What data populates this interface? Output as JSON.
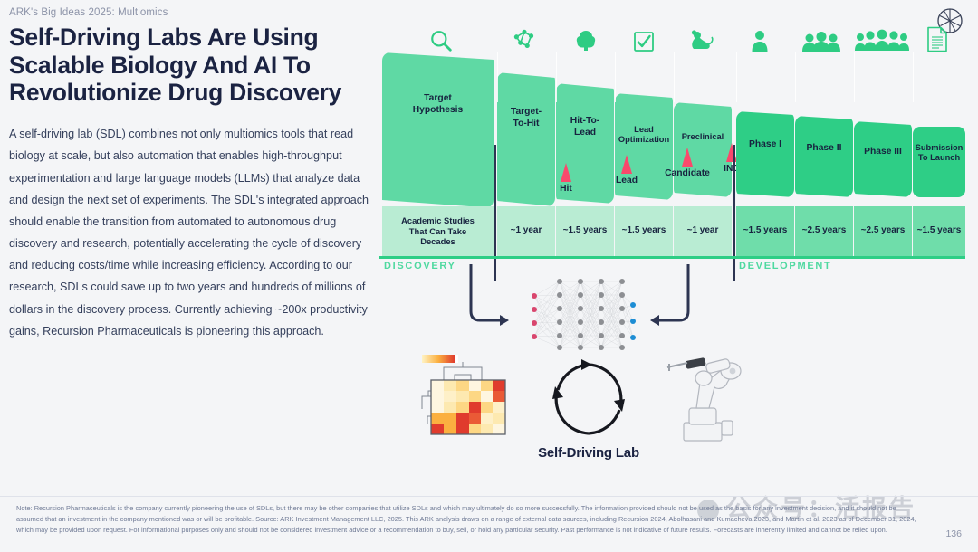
{
  "header": {
    "eyebrow": "ARK's Big Ideas 2025: Multiomics",
    "headline": "Self-Driving Labs Are Using Scalable Biology And AI To Revolutionize Drug Discovery",
    "logo_icon": "ark-logo-icon"
  },
  "body": {
    "paragraph": "A self-driving lab (SDL) combines not only multiomics tools that read biology at scale, but also automation that enables high-throughput experimentation and large language models (LLMs) that analyze data and design the next set of experiments. The SDL's integrated approach should enable the transition from automated to autonomous drug discovery and research, potentially accelerating the cycle of discovery and reducing costs/time while increasing efficiency. According to our research, SDLs could save up to two years and hundreds of millions of dollars in the discovery process. Currently achieving ~200x productivity gains, Recursion Pharmaceuticals is pioneering this approach."
  },
  "funnel": {
    "stages": [
      {
        "label": "Target\nHypothesis",
        "duration": "Academic Studies\nThat Can Take\nDecades",
        "icon": "magnifier-icon",
        "phase": "discovery"
      },
      {
        "label": "Target-\nTo-Hit",
        "duration": "~1 year",
        "icon": "molecule-icon",
        "phase": "discovery"
      },
      {
        "label": "Hit-To-\nLead",
        "duration": "~1.5 years",
        "icon": "compound-icon",
        "phase": "discovery"
      },
      {
        "label": "Lead\nOptimization",
        "duration": "~1.5 years",
        "icon": "checkbox-icon",
        "phase": "discovery"
      },
      {
        "label": "Preclinical",
        "duration": "~1 year",
        "icon": "mouse-icon",
        "phase": "discovery"
      },
      {
        "label": "Phase I",
        "duration": "~1.5 years",
        "icon": "single-person-icon",
        "phase": "development"
      },
      {
        "label": "Phase II",
        "duration": "~2.5 years",
        "icon": "small-group-icon",
        "phase": "development"
      },
      {
        "label": "Phase III",
        "duration": "~2.5 years",
        "icon": "large-group-icon",
        "phase": "development"
      },
      {
        "label": "Submission\nTo Launch",
        "duration": "~1.5 years",
        "icon": "document-icon",
        "phase": "development"
      }
    ],
    "markers": [
      {
        "label": "Hit"
      },
      {
        "label": "Lead"
      },
      {
        "label": "Candidate"
      },
      {
        "label": "IND"
      }
    ],
    "sections": {
      "discovery": "DISCOVERY",
      "development": "DEVELOPMENT"
    },
    "colors": {
      "funnel_light": "#5fd9a4",
      "funnel_dark": "#2ece86",
      "duration_light": "#b9ecd3",
      "duration_dark": "#6fddaa",
      "marker": "#f9496c",
      "section_label": "#4fd9a0"
    }
  },
  "diagram": {
    "neural_net_icon": "neural-network-icon",
    "heatmap_icon": "clustered-heatmap-icon",
    "cycle_icon": "circular-arrow-cycle-icon",
    "robot_icon": "robot-arm-icon",
    "caption": "Self-Driving Lab",
    "arrow_left_icon": "curved-arrow-right-icon",
    "arrow_right_icon": "curved-arrow-left-icon"
  },
  "footer": {
    "note": "Note: Recursion Pharmaceuticals is the company currently pioneering the use of SDLs, but there may be other companies that utilize SDLs and which may ultimately do so more successfully. The information provided should not be used as the basis for any investment decision, and it should not be assumed that an investment in the company mentioned was or will be profitable. Source: ARK Investment Management LLC, 2025. This ARK analysis draws on a range of external data sources, including Recursion 2024, Abolhasani and Kumacheva 2023,  and Martin et al. 2023 as of December 31, 2024, which may be provided upon request. For informational purposes only and should not be considered investment advice or a recommendation to buy, sell, or hold any particular security. Past performance is not indicative of future results. Forecasts are inherently limited and cannot be relied upon.",
    "page_number": "136",
    "watermark": "公众号：活报告"
  }
}
